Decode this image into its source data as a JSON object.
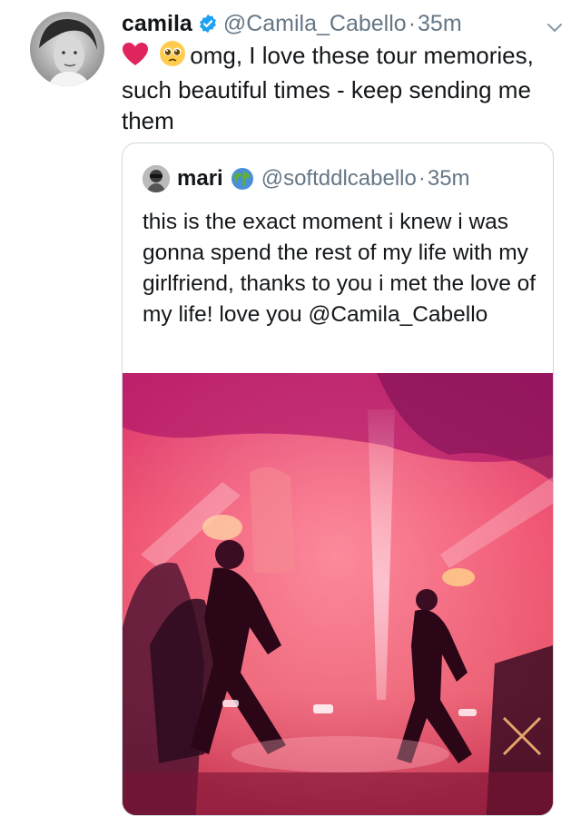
{
  "tweet": {
    "author_name": "camila",
    "author_handle": "@Camila_Cabello",
    "separator": "·",
    "timestamp": "35m",
    "text": "omg, I love these tour memories, such beautiful times - keep sending me them",
    "emojis": [
      "red-heart",
      "pleading-face"
    ]
  },
  "quoted_tweet": {
    "author_name": "mari",
    "author_handle": "@softddlcabello",
    "separator": "·",
    "timestamp": "35m",
    "text": "this is the exact moment i knew i was gonna spend the rest of my life with my girlfriend, thanks to you i met the love of my life! love you @Camila_Cabello",
    "badge_icon": "globe-icon",
    "media": "concert-video-thumbnail"
  },
  "colors": {
    "verified": "#1da1f2",
    "secondary_text": "#657786",
    "primary_text": "#14171a",
    "border": "#cfd9de",
    "heart": "#e0245e"
  }
}
